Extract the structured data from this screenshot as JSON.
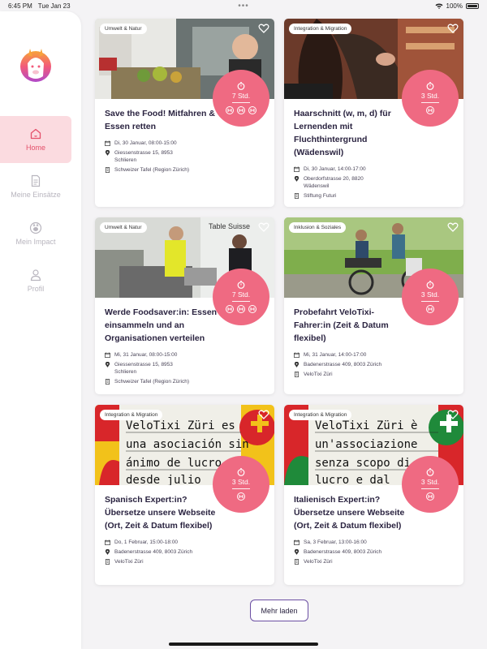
{
  "statusbar": {
    "time": "6:45 PM",
    "date": "Tue Jan 23",
    "dots": "•••",
    "battery": "100%"
  },
  "colors": {
    "accent": "#ef6a82",
    "nav_active_bg": "#fbdbe0",
    "nav_active_fg": "#e4506a"
  },
  "sidebar": {
    "items": [
      {
        "label": "Home",
        "icon": "home-icon",
        "active": true
      },
      {
        "label": "Meine Einsätze",
        "icon": "document-icon",
        "active": false
      },
      {
        "label": "Mein Impact",
        "icon": "impact-icon",
        "active": false
      },
      {
        "label": "Profil",
        "icon": "person-icon",
        "active": false
      }
    ]
  },
  "cards": [
    {
      "tag": "Umwelt & Natur",
      "duration": "7 Std.",
      "title": "Save the Food! Mitfahren & Essen retten",
      "date": "Di, 30 Januar, 08:00-15:00",
      "address_line1": "Giessenstrasse 15, 8953",
      "address_line2": "Schlieren",
      "org": "Schweizer Tafel (Region Zürich)"
    },
    {
      "tag": "Integration & Migration",
      "duration": "3 Std.",
      "title": "Haarschnitt (w, m, d) für Lernenden mit Fluchthintergrund (Wädenswil)",
      "date": "Di, 30 Januar, 14:00-17:00",
      "address_line1": "Oberdorfstrasse 20, 8820",
      "address_line2": "Wädenswil",
      "org": "Stiftung Futuri"
    },
    {
      "tag": "Umwelt & Natur",
      "duration": "7 Std.",
      "title": "Werde Foodsaver:in: Essen einsammeln und an Organisationen verteilen",
      "date": "Mi, 31 Januar, 08:00-15:00",
      "address_line1": "Giessenstrasse 15, 8953",
      "address_line2": "Schlieren",
      "org": "Schweizer Tafel (Region Zürich)"
    },
    {
      "tag": "Inklusion & Soziales",
      "duration": "3 Std.",
      "title": "Probefahrt VeloTixi-Fahrer:in (Zeit & Datum flexibel)",
      "date": "Mi, 31 Januar, 14:00-17:00",
      "address_line1": "Badenerstrasse 409, 8003 Zürich",
      "address_line2": "",
      "org": "VeloTixi Züri"
    },
    {
      "tag": "Integration & Migration",
      "duration": "3 Std.",
      "title": "Spanisch Expert:in? Übersetze unsere Webseite (Ort, Zeit & Datum flexibel)",
      "date": "Do, 1 Februar, 15:00-18:00",
      "address_line1": "Badenerstrasse 409, 8003 Zürich",
      "address_line2": "",
      "org": "VeloTixi Züri",
      "photo_text": [
        "VeloTixi Züri es",
        "una asociación sin",
        "ánimo de lucro",
        "desde julio"
      ]
    },
    {
      "tag": "Integration & Migration",
      "duration": "3 Std.",
      "title": "Italienisch Expert:in? Übersetze unsere Webseite (Ort, Zeit & Datum flexibel)",
      "date": "Sa, 3 Februar, 13:00-16:00",
      "address_line1": "Badenerstrasse 409, 8003 Zürich",
      "address_line2": "",
      "org": "VeloTixi Züri",
      "photo_text": [
        "VeloTixi Züri è",
        "un'associazione",
        "senza scopo di",
        "lucro e dal"
      ]
    }
  ],
  "photo_labels": {
    "truck_brand": "Table Suisse"
  },
  "more_button": "Mehr laden"
}
